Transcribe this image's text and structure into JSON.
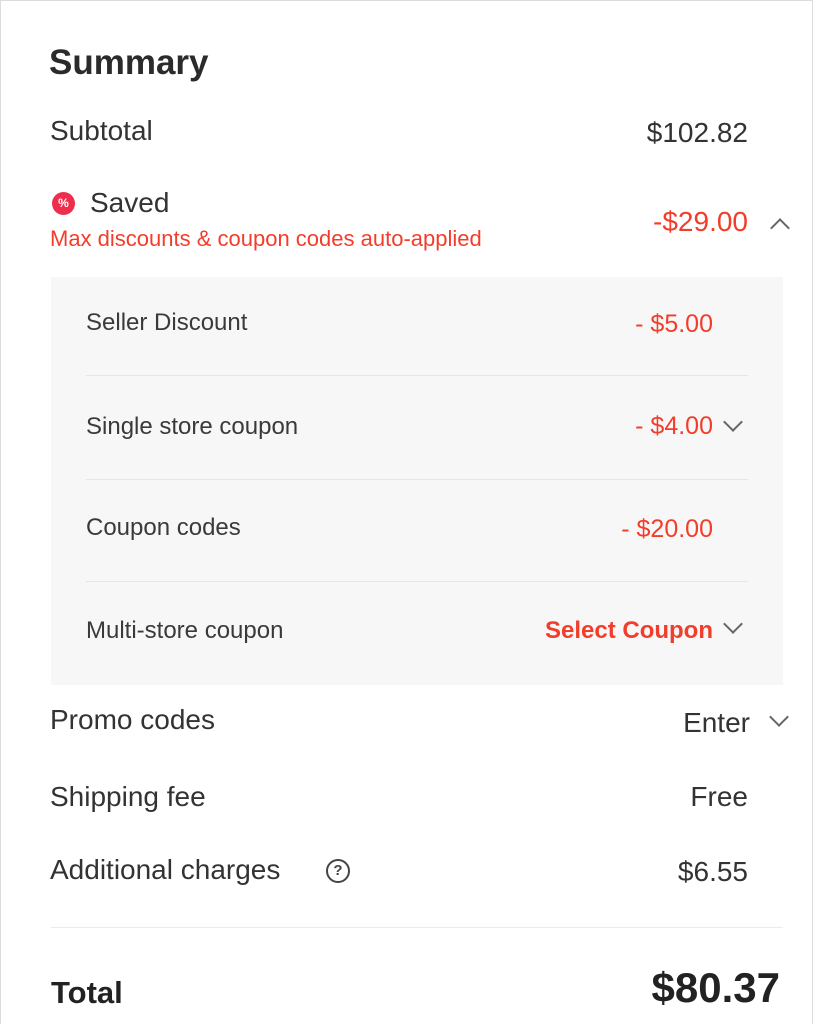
{
  "summary": {
    "title": "Summary",
    "subtotal": {
      "label": "Subtotal",
      "value": "$102.82"
    },
    "saved": {
      "icon": "percent-badge-icon",
      "icon_glyph": "%",
      "label": "Saved",
      "note": "Max discounts & coupon codes auto-applied",
      "value": "-$29.00",
      "expanded": true
    },
    "discounts": [
      {
        "label": "Seller Discount",
        "value": "- $5.00",
        "has_chevron": false
      },
      {
        "label": "Single store coupon",
        "value": "- $4.00",
        "has_chevron": true
      },
      {
        "label": "Coupon codes",
        "value": "- $20.00",
        "has_chevron": false
      },
      {
        "label": "Multi-store coupon",
        "value": "Select Coupon",
        "has_chevron": true
      }
    ],
    "promo": {
      "label": "Promo codes",
      "value": "Enter"
    },
    "shipping": {
      "label": "Shipping fee",
      "value": "Free"
    },
    "additional": {
      "label": "Additional charges",
      "help_glyph": "?",
      "value": "$6.55"
    },
    "total": {
      "label": "Total",
      "value": "$80.37"
    }
  },
  "colors": {
    "accent_red": "#f33d2b",
    "badge_red": "#ef2d4c",
    "text": "#222222",
    "panel_bg": "#f7f7f7"
  }
}
